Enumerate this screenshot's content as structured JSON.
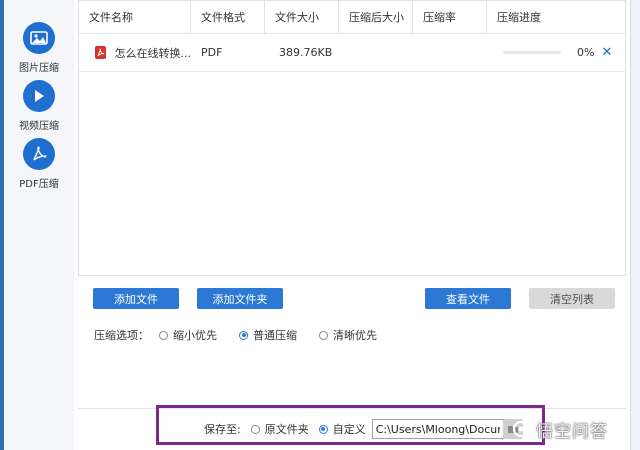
{
  "sidebar": {
    "items": [
      {
        "label": "图片压缩",
        "icon": "image-icon",
        "active": false
      },
      {
        "label": "视频压缩",
        "icon": "play-icon",
        "active": false
      },
      {
        "label": "PDF压缩",
        "icon": "pdf-icon",
        "active": true
      }
    ]
  },
  "table": {
    "headers": [
      "文件名称",
      "文件格式",
      "文件大小",
      "压缩后大小",
      "压缩率",
      "压缩进度"
    ],
    "rows": [
      {
        "name": "怎么在线转换...",
        "format": "PDF",
        "size": "389.76KB",
        "compressed_size": "",
        "ratio": "",
        "progress": 0,
        "progress_text": "0%",
        "remove": "✕"
      }
    ]
  },
  "buttons": {
    "add_file": "添加文件",
    "add_folder": "添加文件夹",
    "view_file": "查看文件",
    "clear_list": "清空列表"
  },
  "compress_options": {
    "label": "压缩选项：",
    "options": [
      {
        "label": "缩小优先",
        "selected": false
      },
      {
        "label": "普通压缩",
        "selected": true
      },
      {
        "label": "清晰优先",
        "selected": false
      }
    ]
  },
  "save": {
    "label": "保存至:",
    "original_folder": "原文件夹",
    "original_selected": false,
    "custom": "自定义",
    "custom_selected": true,
    "path": "C:\\Users\\Mloong\\Documents"
  },
  "watermark": "悟空问答",
  "colors": {
    "accent": "#2b78d5",
    "highlight_box": "#7b2a8b",
    "pdf_red": "#d9342a"
  }
}
